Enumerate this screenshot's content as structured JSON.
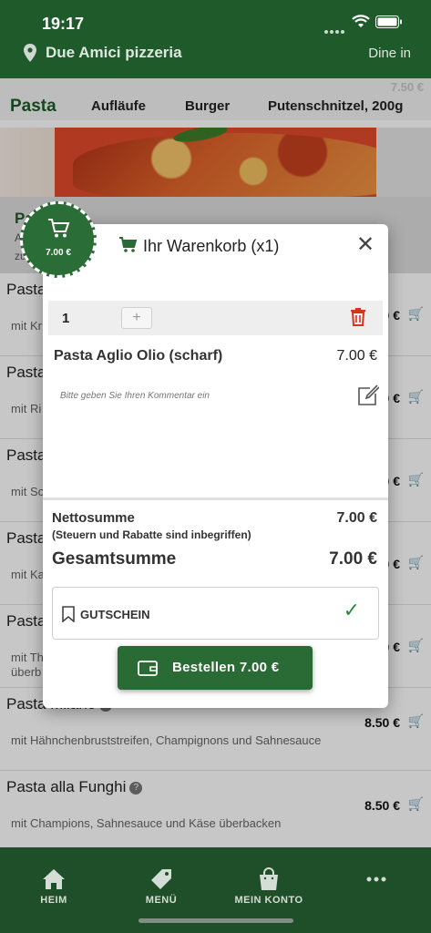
{
  "status": {
    "time": "19:17"
  },
  "header": {
    "store_name": "Due Amici pizzeria",
    "mode": "Dine in"
  },
  "categories": [
    {
      "label": "Pasta",
      "active": true
    },
    {
      "label": "Aufläufe"
    },
    {
      "label": "Burger"
    },
    {
      "label": "Putenschnitzel, 200g"
    }
  ],
  "ghost_price": "7.50 €",
  "group": {
    "title": "Pa",
    "sub1": "A",
    "sub2": "zu"
  },
  "items": [
    {
      "name": "Pasta",
      "desc": "mit Kr",
      "price": "0 €"
    },
    {
      "name": "Pasta",
      "desc": "mit Ri",
      "price": "0 €"
    },
    {
      "name": "Pasta",
      "desc": "mit So",
      "price": "0 €"
    },
    {
      "name": "Pasta",
      "desc": "mit Ka",
      "price": "0 €"
    },
    {
      "name": "Pasta",
      "desc": "mit Th",
      "desc2": "überb",
      "price": "0 €"
    },
    {
      "name": "Pasta Milano",
      "desc": "mit Hähnchenbruststreifen, Champignons und Sahnesauce",
      "price": "8.50 €"
    },
    {
      "name": "Pasta alla Funghi",
      "desc": "mit Champions, Sahnesauce und Käse überbacken",
      "price": "8.50 €"
    }
  ],
  "cart_badge": {
    "amount": "7.00 €"
  },
  "modal": {
    "title": "Ihr Warenkorb (x1)",
    "qty": "1",
    "plus": "+",
    "line_name": "Pasta Aglio Olio (scharf)",
    "line_price": "7.00 €",
    "comment_placeholder": "Bitte geben Sie Ihren Kommentar ein",
    "net_label": "Nettosumme",
    "net_value": "7.00 €",
    "net_note": "(Steuern und Rabatte sind inbegriffen)",
    "total_label": "Gesamtsumme",
    "total_value": "7.00 €",
    "voucher_label": "GUTSCHEIN",
    "order_label": "Bestellen 7.00 €"
  },
  "tabs": [
    {
      "label": "HEIM",
      "icon": "home-icon"
    },
    {
      "label": "MENÜ",
      "icon": "tag-icon"
    },
    {
      "label": "MEIN KONTO",
      "icon": "bag-icon"
    },
    {
      "label": "",
      "icon": "more-icon"
    }
  ],
  "colors": {
    "brand": "#1f5a2b",
    "accent": "#2a6a34",
    "delete": "#d9331f",
    "check": "#2f8a3b"
  }
}
